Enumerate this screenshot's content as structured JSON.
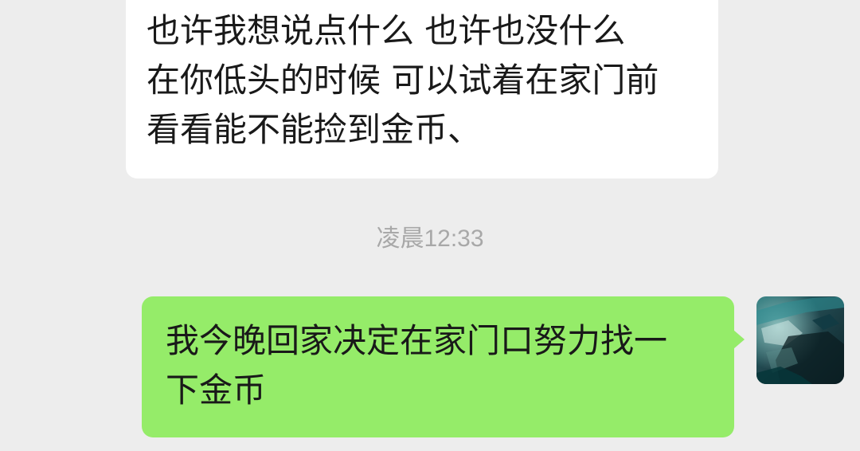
{
  "chat": {
    "messages": [
      {
        "side": "received",
        "text": "也许我想说点什么 也许也没什么\n在你低头的时候 可以试着在家门前\n看看能不能捡到金币、"
      },
      {
        "side": "sent",
        "text": "我今晚回家决定在家门口努力找一\n下金币"
      }
    ],
    "timestamp": "凌晨12:33"
  },
  "colors": {
    "background": "#ededed",
    "received_bubble": "#ffffff",
    "sent_bubble": "#95ec69",
    "timestamp_text": "#a8a8a8",
    "message_text": "#191919"
  },
  "icons": {
    "avatar": "user-avatar"
  }
}
